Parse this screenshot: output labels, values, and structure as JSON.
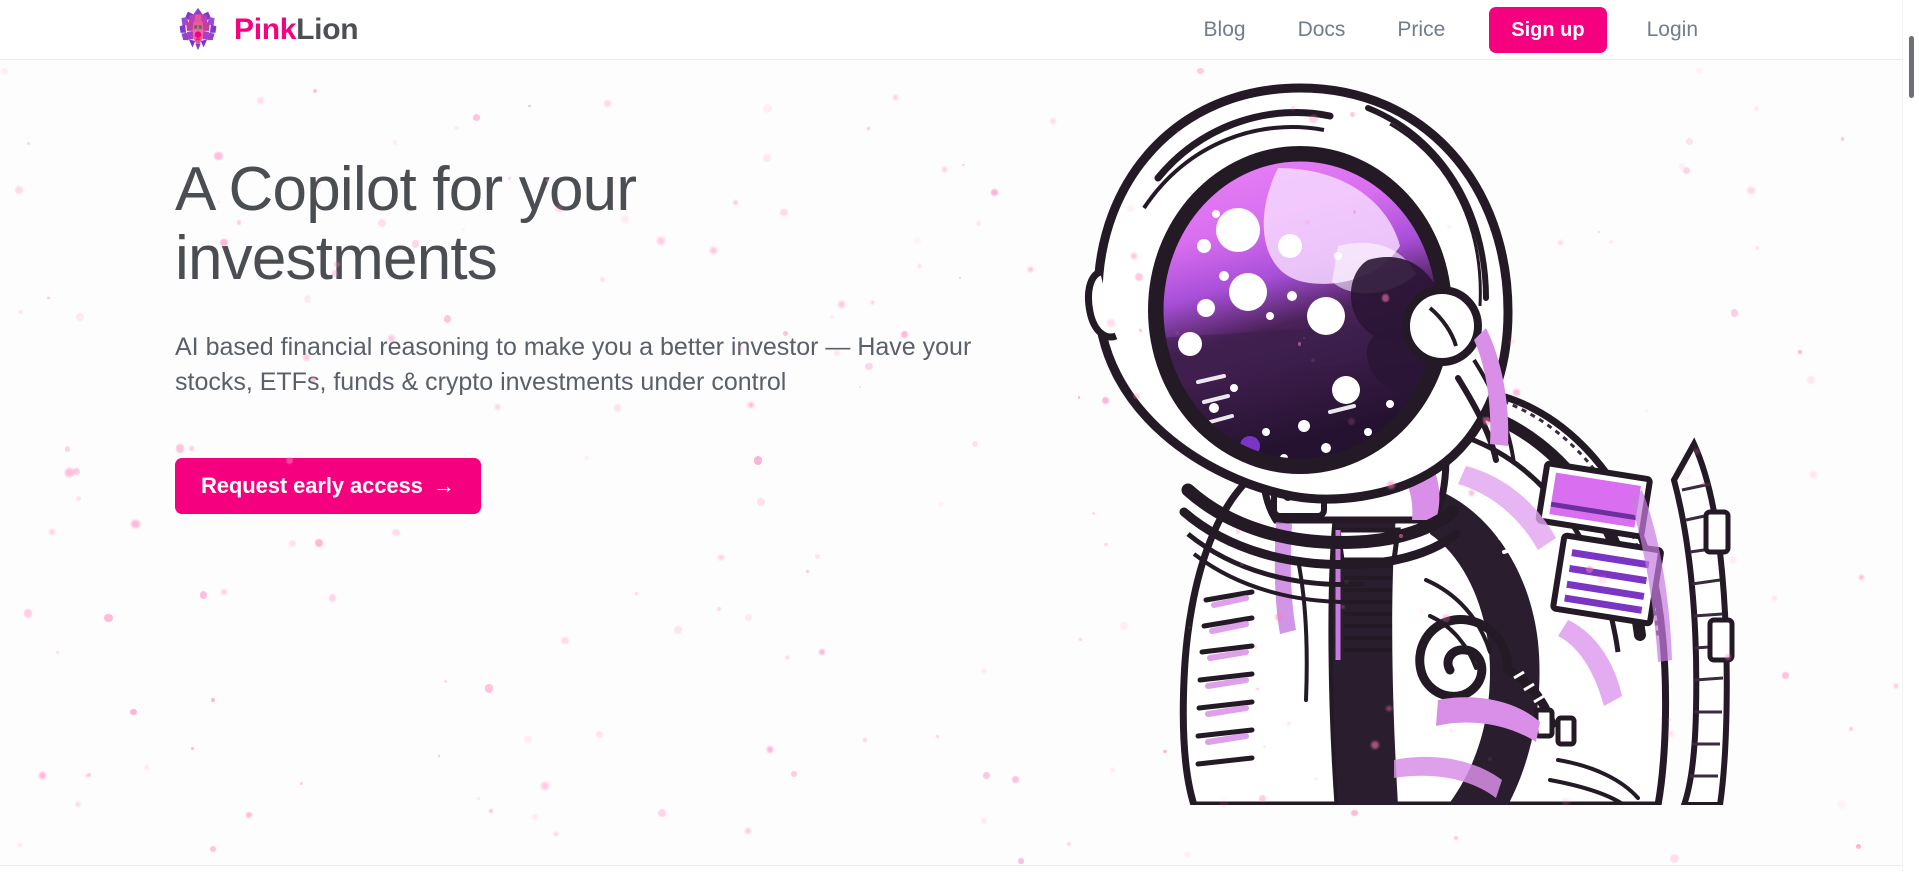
{
  "brand": {
    "name_first": "Pink",
    "name_second": "Lion",
    "logo_icon": "lion-head-icon",
    "color_pink": "#f5007e",
    "color_dark": "#4c4f54"
  },
  "nav": {
    "items": [
      {
        "label": "Blog"
      },
      {
        "label": "Docs"
      },
      {
        "label": "Price"
      }
    ],
    "signup_label": "Sign up",
    "login_label": "Login"
  },
  "hero": {
    "title": "A Copilot for your investments",
    "subtitle": "AI based financial reasoning to make you a better investor — Have your stocks, ETFs, funds & crypto investments under control",
    "cta_label": "Request early access",
    "cta_arrow": "→",
    "illustration": "astronaut-illustration"
  },
  "theme": {
    "accent": "#f5007e",
    "background": "#fefdfe",
    "text_heading": "#4a4d51",
    "text_body": "#5a6068",
    "nav_text": "#717d8c",
    "visor_light": "#e07bf5",
    "visor_dark": "#2a1535"
  }
}
